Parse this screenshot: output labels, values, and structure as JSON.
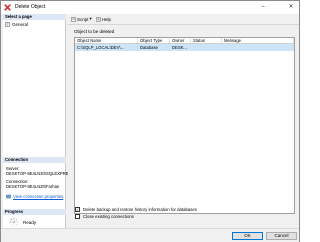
{
  "window": {
    "title": "Delete Object",
    "minimize_glyph": "–",
    "close_glyph": "✕"
  },
  "left_pane": {
    "select_page_header": "Select a page",
    "pages": [
      {
        "label": "General",
        "icon": "page-icon"
      }
    ],
    "connection": {
      "header": "Connection",
      "server_label": "Server:",
      "server_value": "DESKTOP-9E4LN30\\SQLEXPRE",
      "connection_label": "Connection:",
      "connection_value": "DESKTOP-9E4LN30\\Farhan",
      "view_link": "View connection properties"
    },
    "progress": {
      "header": "Progress",
      "status": "Ready"
    }
  },
  "toolbar": {
    "script_label": "Script",
    "script_arrow": "▾",
    "help_label": "Help"
  },
  "main": {
    "object_label": "Object to be deleted",
    "columns": [
      "Object Name",
      "Object Type",
      "Owner",
      "Status",
      "Message"
    ],
    "rows": [
      {
        "name": "C:\\SQLP_LOCAL\\DEV\\...",
        "type": "Database",
        "owner": "DESK...",
        "status": "",
        "message": ""
      }
    ],
    "options": [
      {
        "label": "Delete backup and restore history information for databases",
        "checked": true
      },
      {
        "label": "Close existing connections",
        "checked": false
      }
    ]
  },
  "footer": {
    "ok_label": "OK",
    "cancel_label": "Cancel"
  },
  "colors": {
    "accent": "#0078d7",
    "selection": "#cce4f7",
    "header_band": "#dce6f4",
    "link": "#0b5ed7",
    "delete_icon": "#d42c2c"
  }
}
